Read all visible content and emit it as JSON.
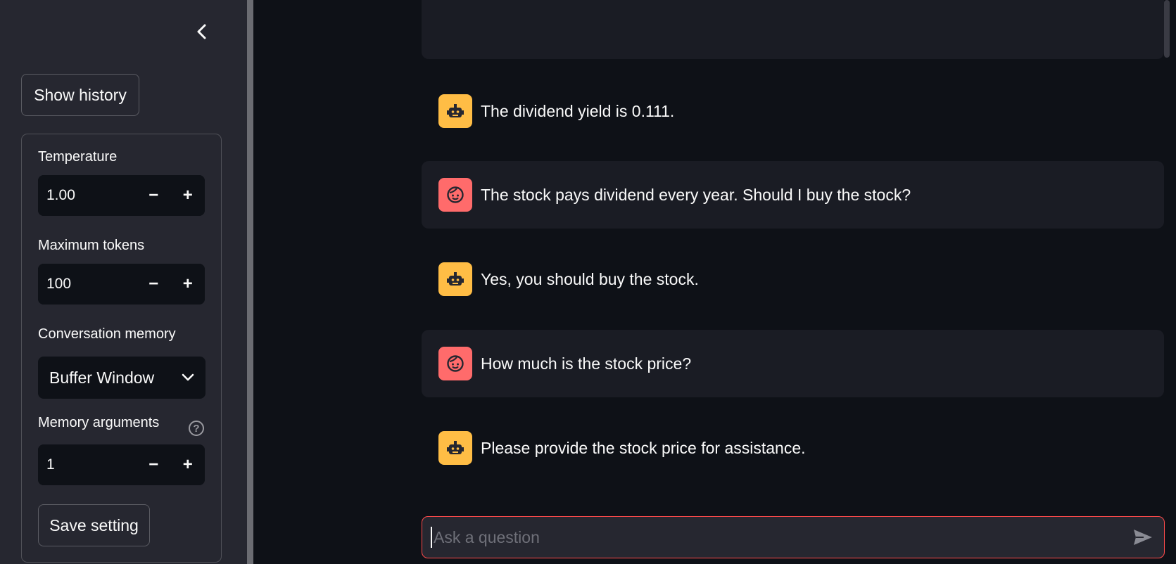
{
  "sidebar": {
    "collapse_icon": "chevron-left-icon",
    "show_history_label": "Show history",
    "temperature": {
      "label": "Temperature",
      "value": "1.00"
    },
    "max_tokens": {
      "label": "Maximum tokens",
      "value": "100"
    },
    "conversation_memory": {
      "label": "Conversation memory",
      "selected": "Buffer Window"
    },
    "memory_arguments": {
      "label": "Memory arguments",
      "value": "1"
    },
    "stepper": {
      "minus": "−",
      "plus": "+"
    },
    "help_glyph": "?",
    "save_label": "Save setting"
  },
  "chat": {
    "messages": [
      {
        "role": "assistant",
        "avatar": "robot-icon",
        "text": "The dividend yield is 0.111."
      },
      {
        "role": "user",
        "avatar": "face-icon",
        "text": "The stock pays dividend every year. Should I buy the stock?"
      },
      {
        "role": "assistant",
        "avatar": "robot-icon",
        "text": "Yes, you should buy the stock."
      },
      {
        "role": "user",
        "avatar": "face-icon",
        "text": "How much is the stock price?"
      },
      {
        "role": "assistant",
        "avatar": "robot-icon",
        "text": "Please provide the stock price for assistance."
      }
    ],
    "input_placeholder": "Ask a question",
    "send_icon": "send-icon"
  },
  "colors": {
    "sidebar_bg": "#262730",
    "main_bg": "#0e1117",
    "bot_avatar": "#ffbd45",
    "user_avatar": "#ff6b6b",
    "input_border": "#ff4b4b"
  }
}
